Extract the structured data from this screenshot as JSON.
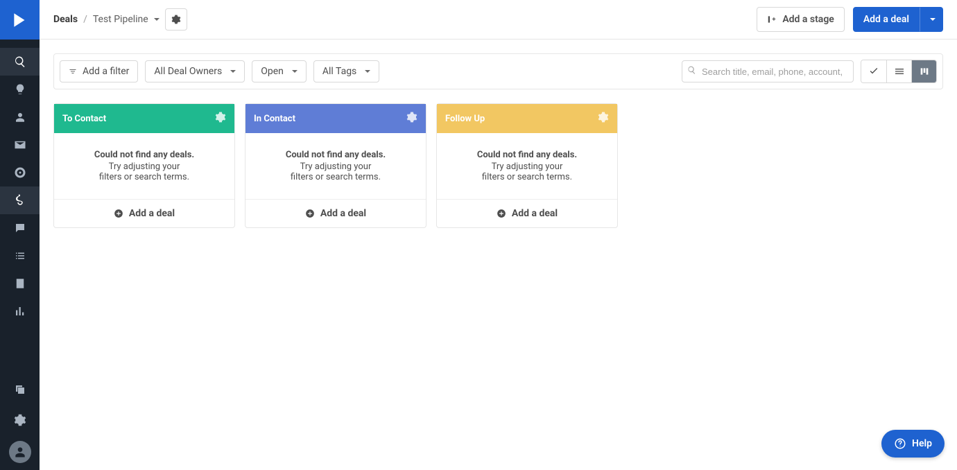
{
  "breadcrumb": {
    "root": "Deals",
    "sep": "/",
    "pipeline": "Test Pipeline"
  },
  "topbar": {
    "add_stage": "Add a stage",
    "add_deal": "Add a deal"
  },
  "filters": {
    "add_filter": "Add a filter",
    "owners": "All Deal Owners",
    "status": "Open",
    "tags": "All Tags"
  },
  "search": {
    "placeholder": "Search title, email, phone, account,"
  },
  "stages": [
    {
      "name": "To Contact",
      "empty_title": "Could not find any deals.",
      "empty_line1": "Try adjusting your",
      "empty_line2": "filters or search terms.",
      "add_label": "Add a deal"
    },
    {
      "name": "In Contact",
      "empty_title": "Could not find any deals.",
      "empty_line1": "Try adjusting your",
      "empty_line2": "filters or search terms.",
      "add_label": "Add a deal"
    },
    {
      "name": "Follow Up",
      "empty_title": "Could not find any deals.",
      "empty_line1": "Try adjusting your",
      "empty_line2": "filters or search terms.",
      "add_label": "Add a deal"
    }
  ],
  "help": {
    "label": "Help"
  }
}
